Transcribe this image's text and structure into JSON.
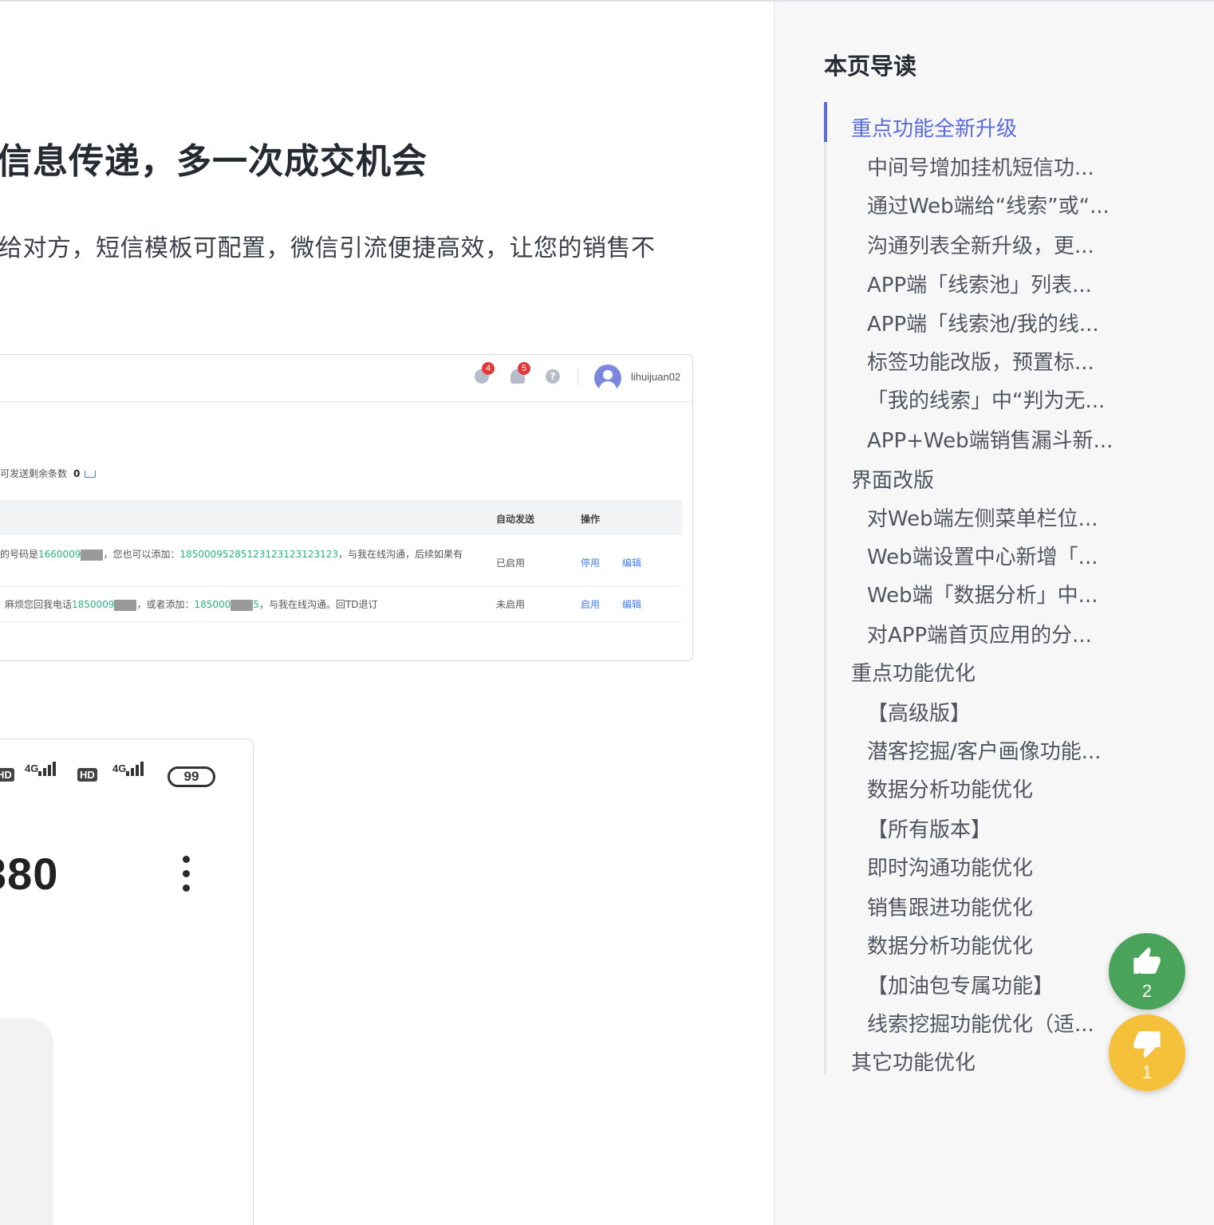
{
  "article": {
    "heading": "信息传递，多一次成交机会",
    "paragraph": "给对方，短信模板可配置，微信引流便捷高效，让您的销售不"
  },
  "web_screenshot": {
    "badges": {
      "chat": "4",
      "bell": "5"
    },
    "help": "?",
    "username": "lihuijuan02",
    "remaining_label": "可发送剩余条数",
    "remaining_count": "0",
    "columns": {
      "auto": "自动发送",
      "ops": "操作"
    },
    "rows": [
      {
        "t1": "的号码是",
        "g1": "1660009",
        "t2": "，您也可以添加：",
        "g2": "18500095285123123123123123",
        "t3": "，与我在线沟通，后续如果有",
        "status": "已启用",
        "action1": "停用",
        "action2": "编辑"
      },
      {
        "t1": "麻烦您回我电话",
        "g1": "1850009",
        "t2": "，或者添加：",
        "g2": "185000",
        "g3": "5",
        "t3": "，与我在线沟通。回TD退订",
        "status": "未启用",
        "action1": "启用",
        "action2": "编辑"
      }
    ]
  },
  "phone_screenshot": {
    "hd1": "HD",
    "net1": "4G",
    "hd2": "HD",
    "net2": "4G",
    "battery": "99",
    "number": "380"
  },
  "toc": {
    "title": "本页导读",
    "items": [
      "重点功能全新升级",
      "中间号增加挂机短信功...",
      "通过Web端给“线索”或“...",
      "沟通列表全新升级，更...",
      "APP端「线索池」列表...",
      "APP端「线索池/我的线...",
      "标签功能改版，预置标...",
      "「我的线索」中“判为无...",
      "APP+Web端销售漏斗新...",
      "界面改版",
      "对Web端左侧菜单栏位...",
      "Web端设置中心新增「...",
      "Web端「数据分析」中...",
      "对APP端首页应用的分...",
      "重点功能优化",
      "【高级版】",
      "潜客挖掘/客户画像功能...",
      "数据分析功能优化",
      "【所有版本】",
      "即时沟通功能优化",
      "销售跟进功能优化",
      "数据分析功能优化",
      "【加油包专属功能】",
      "线索挖掘功能优化（适...",
      "其它功能优化"
    ]
  },
  "feedback": {
    "like_count": "2",
    "dislike_count": "1"
  },
  "colors": {
    "accent": "#5b6ae0",
    "like": "#4aa35a",
    "dislike": "#f5c13b",
    "link": "#3f7cf0",
    "phone_green": "#27b47f"
  }
}
